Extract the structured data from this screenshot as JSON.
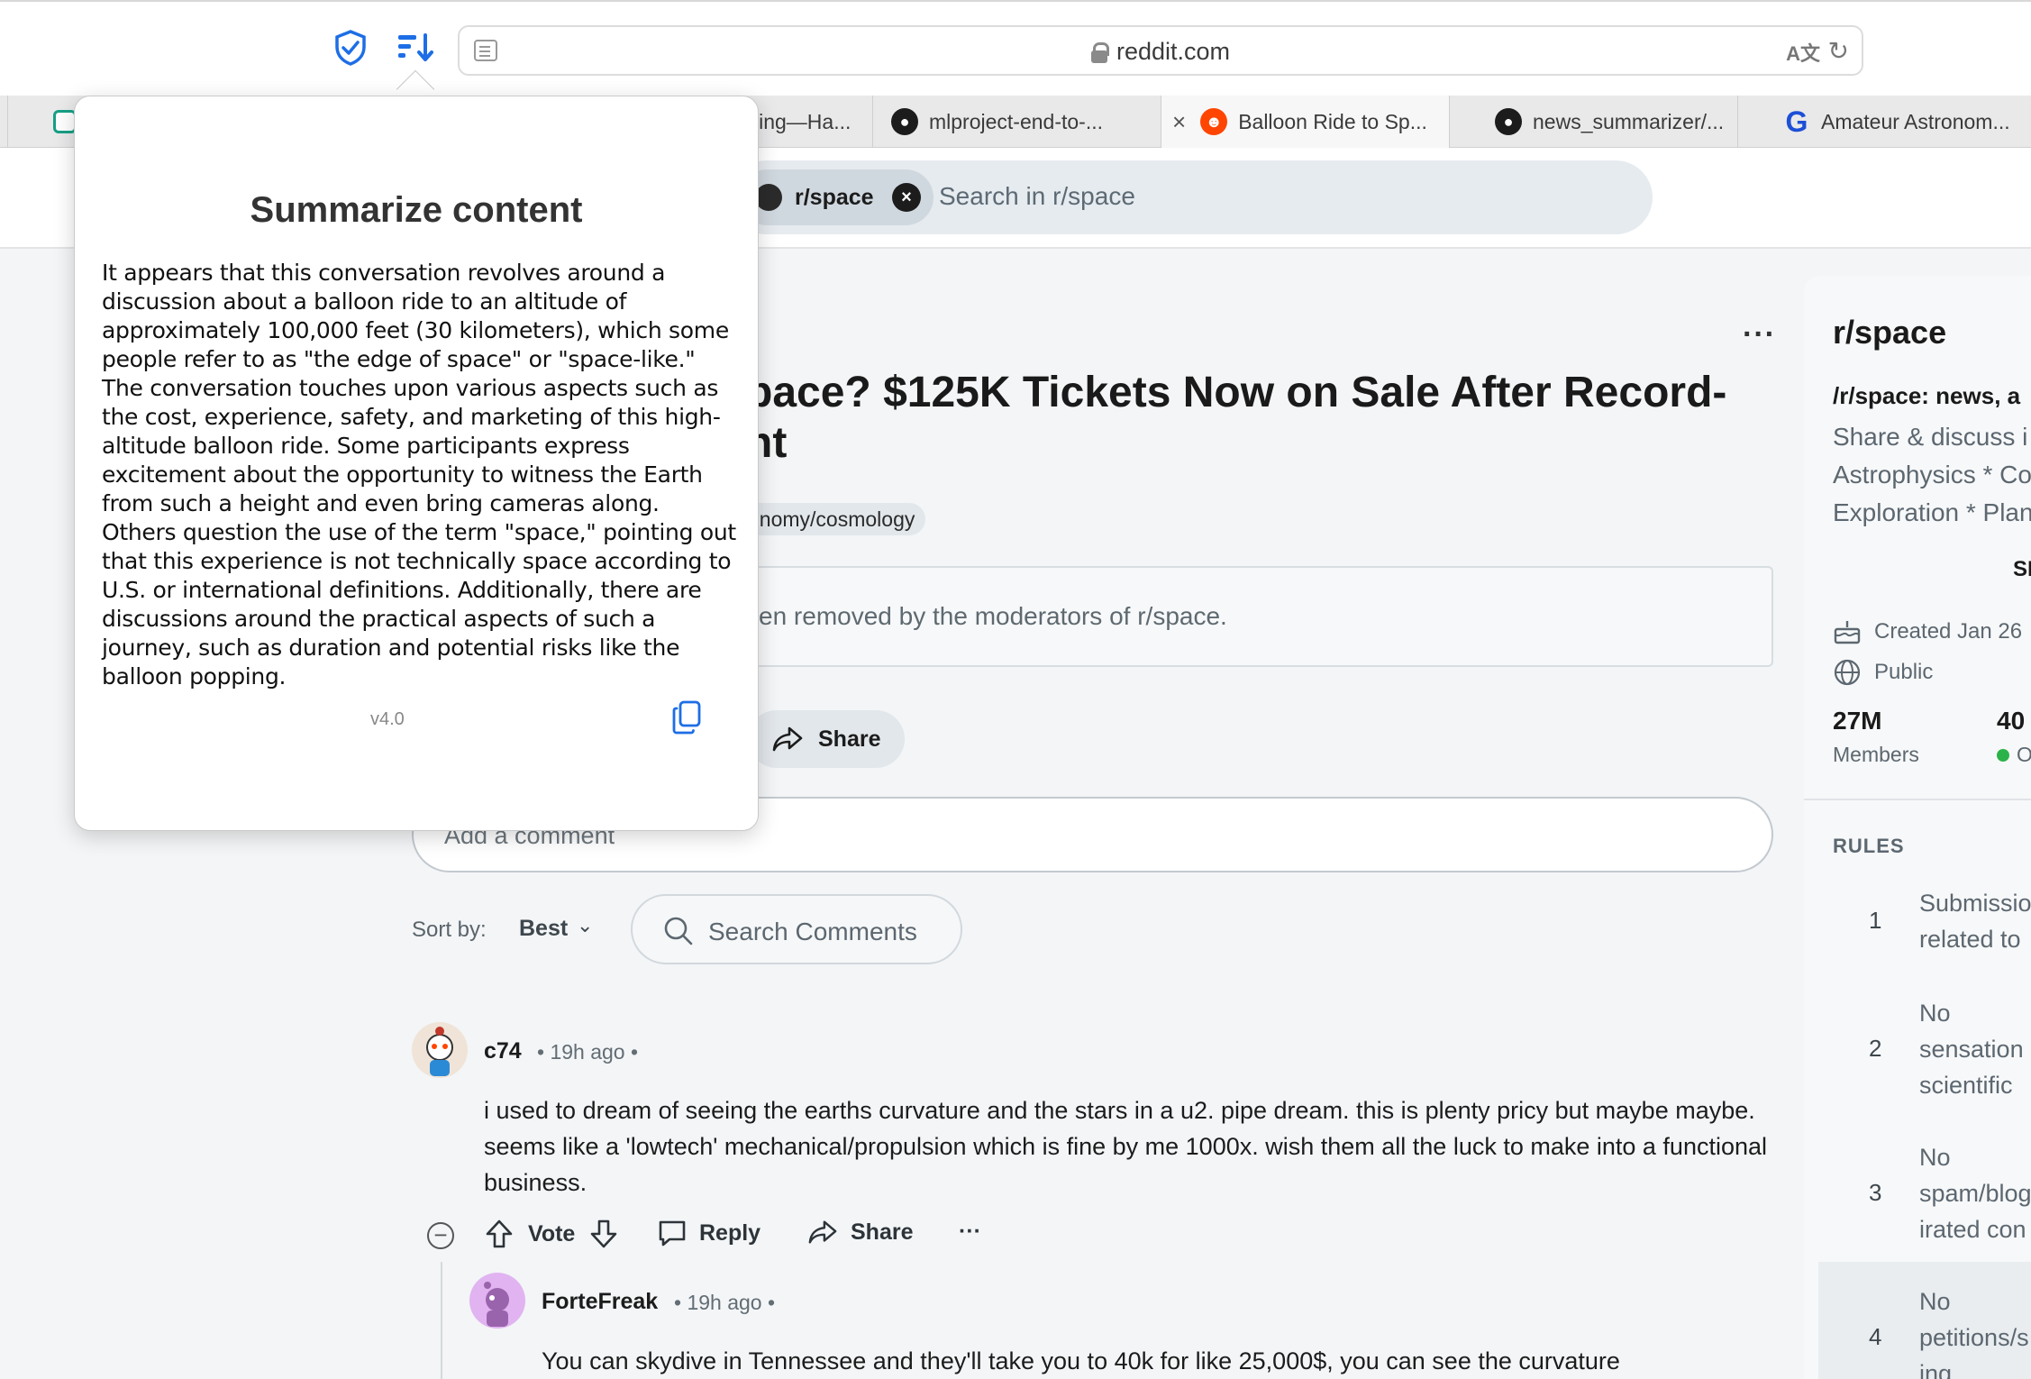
{
  "browser": {
    "url": "reddit.com",
    "tabs": [
      {
        "label": "ling—Ha...",
        "favicon": "book-icon"
      },
      {
        "label": "mlproject-end-to-...",
        "favicon": "github-icon"
      },
      {
        "label": "Balloon Ride to Sp...",
        "favicon": "reddit-icon",
        "active": true
      },
      {
        "label": "news_summarizer/...",
        "favicon": "github-icon"
      },
      {
        "label": "Amateur Astronom...",
        "favicon": "google-icon"
      }
    ]
  },
  "header": {
    "community_chip": "r/space",
    "search_placeholder": "Search in r/space"
  },
  "post": {
    "title": "pace? $125K Tickets Now on Sale After Record-\nht",
    "flair": "onomy/cosmology",
    "removed_notice": "en removed by the moderators of r/space.",
    "share_label": "Share",
    "comment_placeholder": "Add a comment",
    "sort_label": "Sort by:",
    "sort_value": "Best",
    "search_comments_placeholder": "Search Comments"
  },
  "comments": [
    {
      "user": "c74",
      "meta": "• 19h ago •",
      "body": "i used to dream of seeing the earths curvature and the stars in a u2. pipe dream. this is plenty pricy but maybe maybe. seems like a 'lowtech' mechanical/propulsion which is fine by me 1000x. wish them all the luck to make into a functional business.",
      "vote_label": "Vote",
      "reply_label": "Reply",
      "share_label": "Share",
      "more": "···"
    },
    {
      "user": "ForteFreak",
      "meta": "• 19h ago •",
      "body": "You can skydive in Tennessee and they'll take you to 40k for like 25,000$, you can see the curvature"
    }
  ],
  "sidebar": {
    "title": "r/space",
    "subtitle": "/r/space: news, a",
    "desc_lines": [
      "Share & discuss i",
      "Astrophysics * Co",
      "Exploration * Plan"
    ],
    "sl": "SI",
    "created": "Created Jan 26",
    "visibility": "Public",
    "members_count": "27M",
    "members_label": "Members",
    "online_count": "40",
    "online_label": "O",
    "rules_heading": "RULES",
    "rules": [
      {
        "num": "1",
        "lines": [
          "Submissio",
          "related to"
        ]
      },
      {
        "num": "2",
        "lines": [
          "No",
          "sensation",
          "scientific"
        ]
      },
      {
        "num": "3",
        "lines": [
          "No",
          "spam/blog",
          "irated con"
        ]
      },
      {
        "num": "4",
        "lines": [
          "No",
          "petitions/s",
          "ing"
        ]
      }
    ]
  },
  "popup": {
    "title": "Summarize content",
    "body": "It appears that this conversation revolves around a discussion about a balloon ride to an altitude of approximately 100,000 feet (30 kilometers), which some people refer to as \"the edge of space\" or \"space-like.\" The conversation touches upon various aspects such as the cost, experience, safety, and marketing of this high-altitude balloon ride. Some participants express excitement about the opportunity to witness the Earth from such a height and even bring cameras along. Others question the use of the term \"space,\" pointing out that this experience is not technically space according to U.S. or international definitions. Additionally, there are discussions around the practical aspects of such a journey, such as duration and potential risks like the balloon popping.",
    "version": "v4.0"
  },
  "colors": {
    "reddit_orange": "#ff4500",
    "link_blue": "#1d6ee6",
    "online_green": "#2bb34a"
  }
}
